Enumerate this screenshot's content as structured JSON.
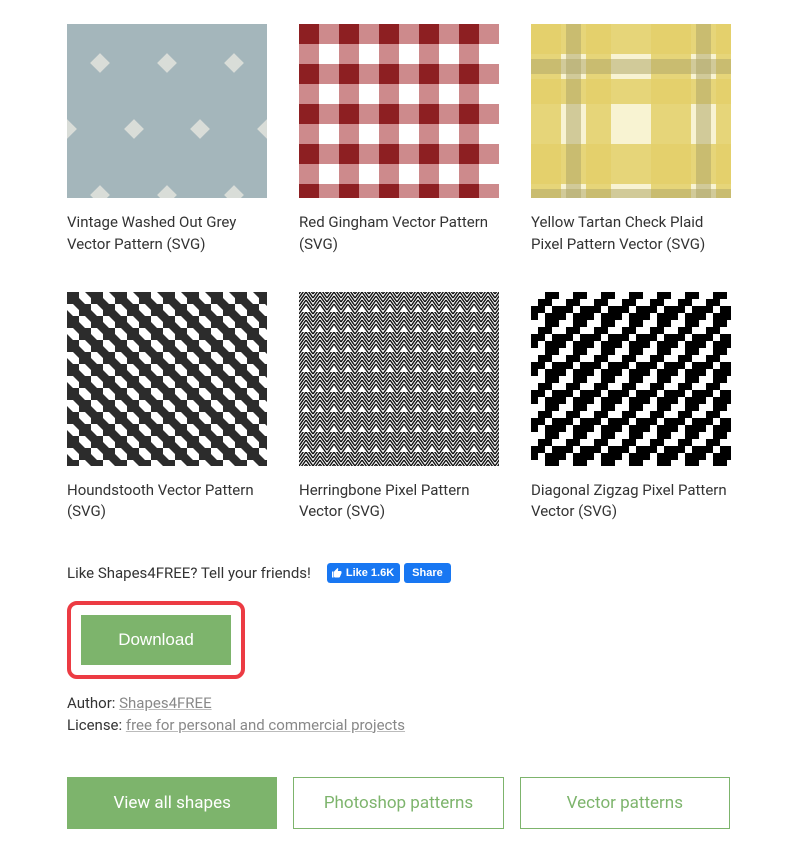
{
  "patterns": [
    {
      "title": "Vintage Washed Out Grey Vector Pattern (SVG)"
    },
    {
      "title": "Red Gingham Vector Pattern (SVG)"
    },
    {
      "title": "Yellow Tartan Check Plaid Pixel Pattern Vector (SVG)"
    },
    {
      "title": "Houndstooth Vector Pattern (SVG)"
    },
    {
      "title": "Herringbone Pixel Pattern Vector (SVG)"
    },
    {
      "title": "Diagonal Zigzag Pixel Pattern Vector (SVG)"
    }
  ],
  "share": {
    "prompt": "Like Shapes4FREE? Tell your friends!",
    "like_label": "Like",
    "like_count": "1.6K",
    "share_label": "Share"
  },
  "download": {
    "label": "Download"
  },
  "meta": {
    "author_label": "Author: ",
    "author_name": "Shapes4FREE",
    "license_label": "License: ",
    "license_text": "free for personal and commercial projects"
  },
  "cta": {
    "view_all": "View all shapes",
    "ps_patterns": "Photoshop patterns",
    "vector_patterns": "Vector patterns"
  }
}
